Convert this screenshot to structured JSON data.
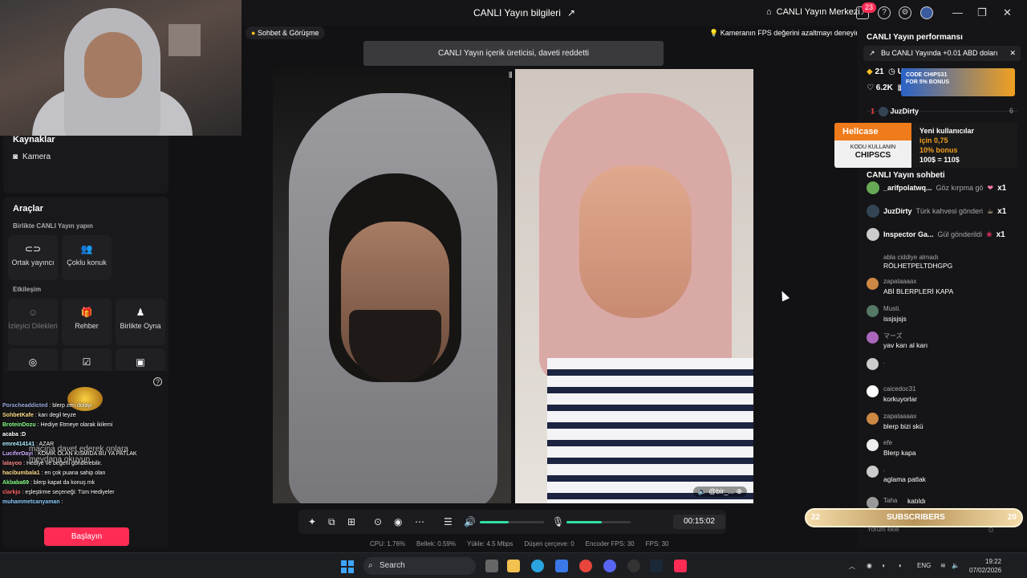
{
  "header": {
    "title": "CANLI Yayın bilgileri",
    "center_link": "CANLI Yayın Merkezi",
    "notifications": "23"
  },
  "left": {
    "sources_title": "Kaynaklar",
    "camera": "Kamera",
    "tools_title": "Araçlar",
    "together_title": "Birlikte CANLI Yayın yapın",
    "tools_a": [
      {
        "label": "Ortak yayıncı",
        "icon": "link-icon"
      },
      {
        "label": "Çoklu konuk",
        "icon": "users-icon"
      }
    ],
    "interaction_title": "Etkileşim",
    "tools_b": [
      {
        "label": "İzleyici Dilekleri",
        "icon": "person-icon"
      },
      {
        "label": "Rehber",
        "icon": "gift-icon"
      },
      {
        "label": "Birlikte Oyna",
        "icon": "play-icon"
      }
    ],
    "start_button": "Başlayın"
  },
  "chat_overlay": [
    {
      "user": "Porscheaddicted",
      "text": "blerp zen dolayı"
    },
    {
      "user": "SohbetKafe",
      "text": "karı degil teyze"
    },
    {
      "user": "BroteinDozu",
      "text": "Hediye Etmeye olarak ikilemi"
    },
    {
      "user": "acaba :D",
      "text": ""
    },
    {
      "user": "emre414141",
      "text": "AZAR"
    },
    {
      "user": "LuciferDayi",
      "text": "KOMİK OLAN KISMIDA BU YA PATLAK"
    },
    {
      "user": "lalayoo",
      "text": "Hediye ve beğeni gönderebilir."
    },
    {
      "user": "hacibumbala1",
      "text": "en çok puana sahip olan"
    },
    {
      "user": "Akbaba69",
      "text": "blerp kapat da konuş mk"
    },
    {
      "user": "clarkjo",
      "text": "eşleştirme seçeneği: Tüm Hediyeler"
    },
    {
      "user": "muhammetcanyaman",
      "text": ""
    }
  ],
  "chat_overlay_banner": "maçına davet ederek onlara meydana okuyun",
  "center": {
    "pill": "Sohbet & Görüşme",
    "tip": "Kameranın FPS değerini azaltmayı deneyin",
    "toast": "CANLI Yayın içerik üreticisi, daveti reddetti",
    "guest_tag": "@bir_...",
    "timer": "00:15:02",
    "volume_level": 0.45,
    "mic_level": 0.55,
    "stats": [
      {
        "label": "CPU:",
        "value": "1.76%"
      },
      {
        "label": "Bellek:",
        "value": "0.59%"
      },
      {
        "label": "Yükle:",
        "value": "4.5 Mbps"
      },
      {
        "label": "Düşen çerçeve:",
        "value": "0"
      },
      {
        "label": "Encoder FPS:",
        "value": "30"
      },
      {
        "label": "FPS:",
        "value": "30"
      }
    ]
  },
  "right": {
    "perf_title": "CANLI Yayın performansı",
    "perf_banner": "Bu CANLI Yayında +0.01 ABD doları",
    "stat_coins": "21",
    "stat_users": "U",
    "stat_likes": "6.2K",
    "ad_code": "CODE CHIPS31",
    "ad_bonus": "FOR 5% BONUS",
    "rank_number": "1",
    "rank_user": "JuzDirty",
    "rank_score": "6",
    "hellcase_brand": "Hellcase",
    "hellcase_code_label": "KODU KULLANIN",
    "hellcase_code": "CHIPSCS",
    "hellcase_promo_1": "Yeni kullanıcılar",
    "hellcase_promo_2": "için 0,75",
    "hellcase_promo_3": "10% bonus",
    "hellcase_promo_4": "100$ = 110$",
    "chat_title": "CANLI Yayın sohbeti",
    "gifts": [
      {
        "user": "_arifpolatwq...",
        "text": "Göz kırpma gö",
        "count": "x1"
      },
      {
        "user": "JuzDirty",
        "text": "Türk kahvesi gönderi",
        "count": "x1"
      },
      {
        "user": "Inspector Ga...",
        "text": "Gül gönderildi",
        "count": "x1"
      }
    ],
    "messages": [
      {
        "user": "abla ciddiye almadı",
        "text": "RÖLHETPELTDHGPG"
      },
      {
        "user": "zapataaaax",
        "text": "ABİ BLERPLERİ KAPA"
      },
      {
        "user": "Musti.",
        "text": "issjsjsjs"
      },
      {
        "user": "マーズ",
        "text": "yav karı al karı"
      },
      {
        "user": ".",
        "text": ""
      },
      {
        "user": "caicedoc31",
        "text": "korkuyorlar"
      },
      {
        "user": "zapataaaax",
        "text": "blerp bizi skü"
      },
      {
        "user": "efe",
        "text": "Blerp kapa"
      },
      {
        "user": ".",
        "text": "aglama patlak"
      },
      {
        "user": "Taha",
        "text": "katıldı"
      }
    ],
    "subs_left": "22",
    "subs_label": "SUBSCRIBERS",
    "subs_right": "20",
    "comment_placeholder": "Yorum ekle"
  },
  "taskbar": {
    "search": "Search",
    "lang": "ENG",
    "time": "19:22",
    "date": "07/02/2026"
  }
}
